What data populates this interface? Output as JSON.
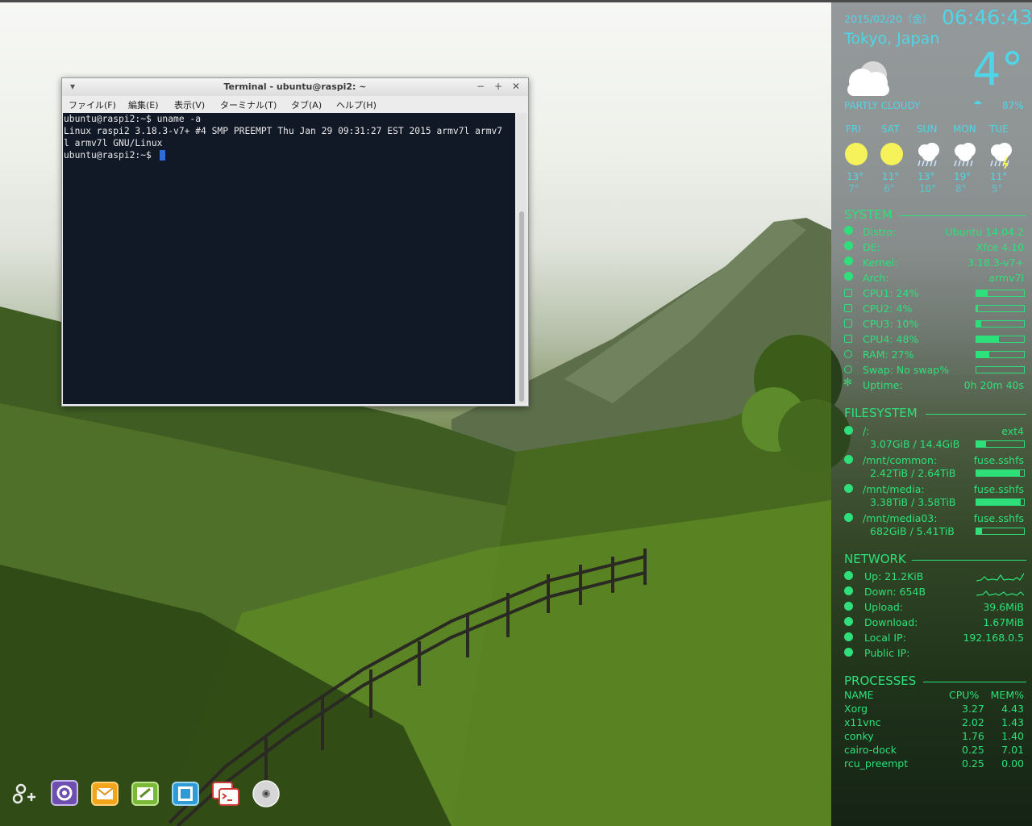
{
  "terminal": {
    "title": "Terminal - ubuntu@raspi2: ~",
    "menu": [
      "ファイル(F)",
      "編集(E)",
      "表示(V)",
      "ターミナル(T)",
      "タブ(A)",
      "ヘルプ(H)"
    ],
    "lines": [
      "ubuntu@raspi2:~$ uname -a",
      "Linux raspi2 3.18.3-v7+ #4 SMP PREEMPT Thu Jan 29 09:31:27 EST 2015 armv7l armv7",
      "l armv7l GNU/Linux",
      "ubuntu@raspi2:~$ "
    ]
  },
  "conky": {
    "date": "2015/02/20（金）",
    "time": "06:46:43",
    "location": "Tokyo, Japan",
    "temperature": "4°",
    "condition": "PARTLY CLOUDY",
    "humidity": "87%",
    "forecast": [
      {
        "day": "FRI",
        "high": "13°",
        "low": "7°",
        "icon": "sun-icon"
      },
      {
        "day": "SAT",
        "high": "11°",
        "low": "6°",
        "icon": "sun-icon"
      },
      {
        "day": "SUN",
        "high": "13°",
        "low": "10°",
        "icon": "rain-cloud-icon"
      },
      {
        "day": "MON",
        "high": "19°",
        "low": "8°",
        "icon": "rain-cloud-icon"
      },
      {
        "day": "TUE",
        "high": "11°",
        "low": "5°",
        "icon": "thunder-rain-icon"
      }
    ],
    "system": {
      "title": "SYSTEM",
      "distro_label": "Distro:",
      "distro": "Ubuntu 14.04.2",
      "de_label": "DE:",
      "de": "Xfce 4.10",
      "kernel_label": "Kernel:",
      "kernel": "3.18.3-v7+",
      "arch_label": "Arch:",
      "arch": "armv7l",
      "cpus": [
        {
          "label": "CPU1: 24%",
          "percent": 24
        },
        {
          "label": "CPU2: 4%",
          "percent": 4
        },
        {
          "label": "CPU3: 10%",
          "percent": 10
        },
        {
          "label": "CPU4: 48%",
          "percent": 48
        }
      ],
      "ram": {
        "label": "RAM: 27%",
        "percent": 27
      },
      "swap": {
        "label": "Swap: No swap%",
        "percent": 0
      },
      "uptime_label": "Uptime:",
      "uptime": "0h 20m 40s"
    },
    "filesystem": {
      "title": "FILESYSTEM",
      "mounts": [
        {
          "path": "/:",
          "type": "ext4",
          "usage": "3.07GiB / 14.4GiB",
          "percent": 21
        },
        {
          "path": "/mnt/common:",
          "type": "fuse.sshfs",
          "usage": "2.42TiB / 2.64TiB",
          "percent": 92
        },
        {
          "path": "/mnt/media:",
          "type": "fuse.sshfs",
          "usage": "3.38TiB / 3.58TiB",
          "percent": 94
        },
        {
          "path": "/mnt/media03:",
          "type": "fuse.sshfs",
          "usage": "682GiB / 5.41TiB",
          "percent": 12
        }
      ]
    },
    "network": {
      "title": "NETWORK",
      "up_label": "Up: 21.2KiB",
      "down_label": "Down: 654B",
      "upload_label": "Upload:",
      "upload": "39.6MiB",
      "download_label": "Download:",
      "download": "1.67MiB",
      "local_ip_label": "Local IP:",
      "local_ip": "192.168.0.5",
      "public_ip_label": "Public IP:",
      "public_ip": ""
    },
    "processes": {
      "title": "PROCESSES",
      "headers": {
        "name": "NAME",
        "cpu": "CPU%",
        "mem": "MEM%"
      },
      "rows": [
        {
          "name": "Xorg",
          "cpu": "3.27",
          "mem": "4.43"
        },
        {
          "name": "x11vnc",
          "cpu": "2.02",
          "mem": "1.43"
        },
        {
          "name": "conky",
          "cpu": "1.76",
          "mem": "1.40"
        },
        {
          "name": "cairo-dock",
          "cpu": "0.25",
          "mem": "7.01"
        },
        {
          "name": "rcu_preempt",
          "cpu": "0.25",
          "mem": "0.00"
        }
      ]
    }
  },
  "dock": {
    "items": [
      "add-launcher-icon",
      "settings-manager-icon",
      "mail-icon",
      "text-editor-icon",
      "file-manager-icon",
      "terminal-icon",
      "disc-icon"
    ]
  },
  "colors": {
    "conky_green": "#2ee07a",
    "conky_cyan": "#4fd6e6",
    "terminal_bg": "#121926"
  }
}
